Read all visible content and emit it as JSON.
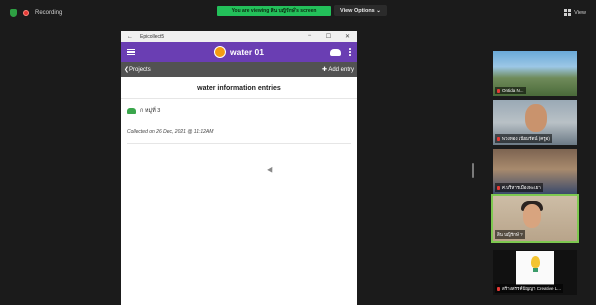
{
  "meeting": {
    "recording_label": "Recording",
    "share_banner": "You are viewing สิน บญิรักษ์'s screen",
    "view_options_label": "View Options ⌄",
    "view_label": "View"
  },
  "shared_window": {
    "tab_title": "Epicollect5",
    "back_glyph": "←",
    "ctrl_min": "−",
    "ctrl_max": "☐",
    "ctrl_close": "✕",
    "app_title": "water 01",
    "projects_label": "❮Projects",
    "add_entry_label": "✚ Add entry",
    "heading": "water information entries",
    "entry": {
      "title": "ก หมู่ที่ 3",
      "collected": "Collected on 26 Dec, 2021 @ 11:12AM"
    }
  },
  "participants": [
    {
      "name": "Ontida N..."
    },
    {
      "name": "พวงทอง เนียมรัตน์ (ครูอ)"
    },
    {
      "name": "ศ.บริหารเมืองพะเยา"
    },
    {
      "name": "สิน บญิรักษ์ ?"
    },
    {
      "name": "สร้างสรรค์ปัญญา Creative L..."
    }
  ],
  "colors": {
    "accent_purple": "#6a3eb3",
    "banner_green": "#23c05a",
    "active_speaker": "#7ec850"
  }
}
